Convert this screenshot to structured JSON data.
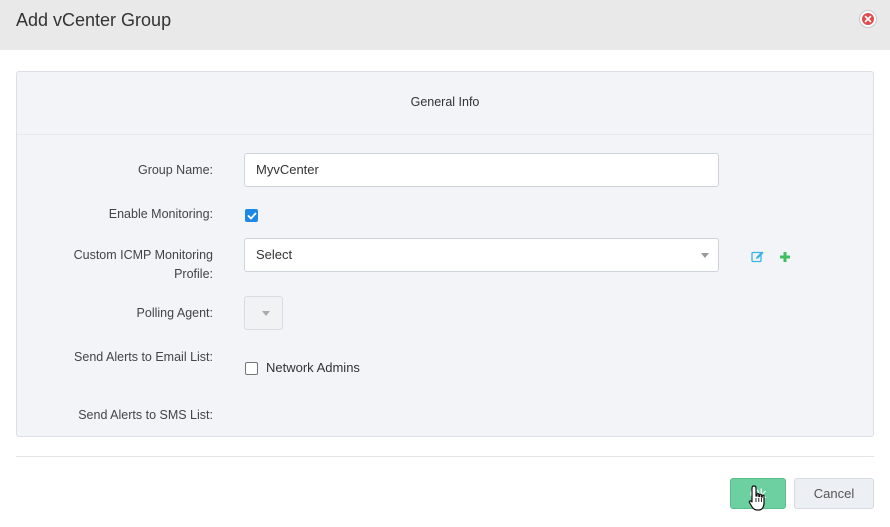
{
  "dialog": {
    "title": "Add vCenter Group"
  },
  "panel": {
    "title": "General Info"
  },
  "form": {
    "group_name_label": "Group Name:",
    "group_name_value": "MyvCenter",
    "enable_monitoring_label": "Enable Monitoring:",
    "enable_monitoring_checked": true,
    "icmp_profile_label_line1": "Custom ICMP Monitoring",
    "icmp_profile_label_line2": "Profile:",
    "icmp_profile_value": "Select",
    "polling_agent_label": "Polling Agent:",
    "email_list_label": "Send Alerts to Email List:",
    "email_list_option": "Network Admins",
    "email_list_option_checked": false,
    "sms_list_label": "Send Alerts to SMS List:"
  },
  "footer": {
    "ok_label": "Ok",
    "cancel_label": "Cancel"
  },
  "colors": {
    "ok_button": "#6dd0a0",
    "close_icon": "#e04b4b",
    "edit_icon": "#37b4e6",
    "add_icon": "#3fbf5f",
    "checkbox_checked": "#1e88e5"
  }
}
